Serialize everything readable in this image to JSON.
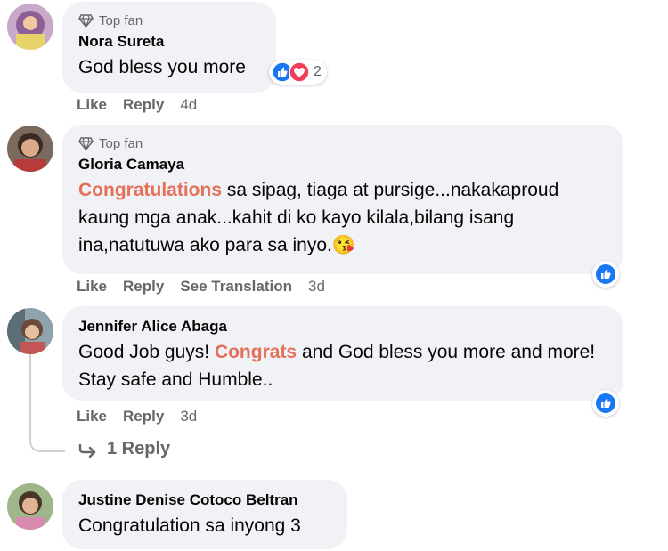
{
  "comments": [
    {
      "top_fan": "Top fan",
      "author": "Nora Sureta",
      "text_parts": [
        "God bless you more"
      ],
      "reaction_count": "2",
      "actions": {
        "like": "Like",
        "reply": "Reply",
        "time": "4d"
      }
    },
    {
      "top_fan": "Top fan",
      "author": "Gloria Camaya",
      "highlight": "Congratulations",
      "text_after": " sa sipag, tiaga at pursige...nakakaproud kaung mga anak...kahit di ko kayo kilala,bilang isang ina,natutuwa ako para sa inyo.",
      "emoji": "😘",
      "actions": {
        "like": "Like",
        "reply": "Reply",
        "translate": "See Translation",
        "time": "3d"
      }
    },
    {
      "author": "Jennifer Alice Abaga",
      "text_before": "Good Job guys! ",
      "highlight": "Congrats",
      "text_after": " and God bless you more and more! Stay safe and Humble..",
      "actions": {
        "like": "Like",
        "reply": "Reply",
        "time": "3d"
      },
      "replies_label": "1 Reply"
    },
    {
      "author": "Justine Denise Cotoco Beltran",
      "text": "Congratulation sa inyong 3"
    }
  ],
  "colors": {
    "highlight": "#e4705a",
    "bubble": "#f0f2f5",
    "like_blue": "#1877f2",
    "love_red": "#f33e58"
  },
  "icons": {
    "top_fan": "diamond-icon",
    "like": "like-reaction-icon",
    "love": "love-reaction-icon",
    "reply_arrow": "reply-arrow-icon"
  }
}
